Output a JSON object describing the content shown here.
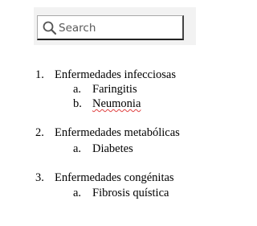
{
  "search": {
    "placeholder": "Search"
  },
  "list": [
    {
      "number": "1.",
      "title": "Enfermedades infecciosas",
      "subitems": [
        {
          "letter": "a.",
          "text": "Faringitis"
        },
        {
          "letter": "b.",
          "text": "Neumonia"
        }
      ]
    },
    {
      "number": "2.",
      "title": "Enfermedades metabólicas",
      "subitems": [
        {
          "letter": "a.",
          "text": "Diabetes"
        }
      ]
    },
    {
      "number": "3.",
      "title": "Enfermedades congénitas",
      "subitems": [
        {
          "letter": "a.",
          "text": "Fibrosis quística"
        }
      ]
    }
  ]
}
